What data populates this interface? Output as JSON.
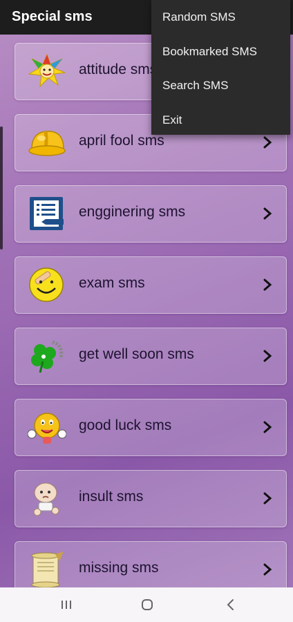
{
  "app": {
    "title": "Special sms"
  },
  "menu": {
    "items": [
      {
        "label": "Random SMS"
      },
      {
        "label": "Bookmarked SMS"
      },
      {
        "label": "Search SMS"
      },
      {
        "label": "Exit"
      }
    ]
  },
  "categories": [
    {
      "label": "attitude sms",
      "icon": "jester-icon"
    },
    {
      "label": "april fool sms",
      "icon": "hard-hat-icon"
    },
    {
      "label": "engginering sms",
      "icon": "document-icon"
    },
    {
      "label": "exam sms",
      "icon": "smiley-bandage-icon"
    },
    {
      "label": "get well soon sms",
      "icon": "clover-icon"
    },
    {
      "label": "good luck sms",
      "icon": "good-luck-smiley-icon"
    },
    {
      "label": "insult sms",
      "icon": "cartoon-baby-icon"
    },
    {
      "label": "missing sms",
      "icon": "scroll-icon"
    }
  ],
  "navigation": [
    "recent-apps-icon",
    "home-icon",
    "back-icon"
  ]
}
